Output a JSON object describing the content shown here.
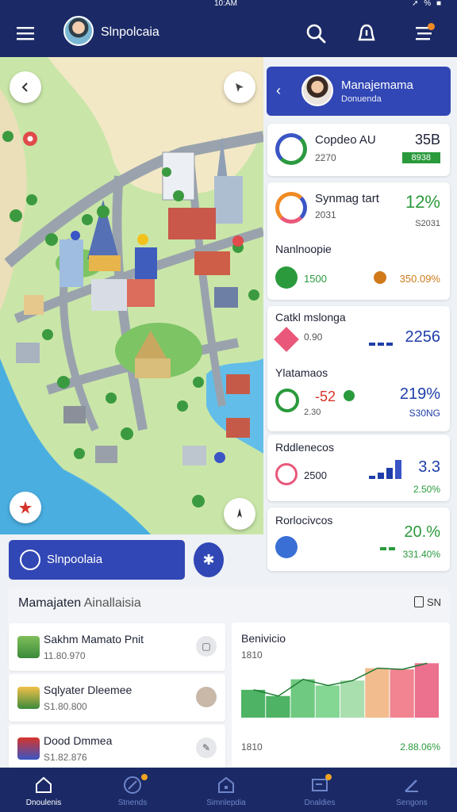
{
  "status_bar": {
    "time": "10:AM",
    "icons": "➚ % ■"
  },
  "app_bar": {
    "title": "Slnpolcaia"
  },
  "details_panel": {
    "header": {
      "title": "Manajemama",
      "subtitle": "Donuenda"
    },
    "cards": [
      {
        "title": "Copdeo AU",
        "subtitle": "2270",
        "value": "35B",
        "badge": "8938"
      },
      {
        "title": "Synmag tart",
        "subtitle": "2031",
        "value": "12%",
        "sub_value": "S2031"
      },
      {
        "title": "Nanlnoopie",
        "left_value": "1500",
        "right_value": "350.09%"
      },
      {
        "title": "Catkl mslonga",
        "left_value": "0.90",
        "value": "2256"
      },
      {
        "title": "Ylatamaos",
        "left_value": "-52",
        "left_sub": "2.30",
        "value": "219%",
        "sub_value": "S30NG"
      },
      {
        "title": "Rddlenecos",
        "left_value": "2500",
        "value": "3.3",
        "sub_value": "2.50%"
      },
      {
        "title": "Rorlocivcos",
        "value": "20.%",
        "sub_value": "331.40%"
      }
    ]
  },
  "map_cta": {
    "label": "Slnpoolaia"
  },
  "bottom_sheet": {
    "title": "Mamajaten",
    "title_suffix": "Ainallaisia",
    "action": "SN",
    "list": [
      {
        "name": "Sakhm Mamato Pnit",
        "sub": "11.80.970"
      },
      {
        "name": "Sqlyater Dleemee",
        "sub": "S1.80.800"
      },
      {
        "name": "Dood Dmmea",
        "sub": "S1.82.876"
      }
    ],
    "chart_card": {
      "title": "Benivicio",
      "top_value": "1810",
      "bottom_left": "1810",
      "bottom_right": "2.88.06%"
    }
  },
  "chart_data": {
    "type": "area",
    "series": [
      {
        "values": [
          45,
          35,
          62,
          52,
          60,
          80,
          78,
          88
        ]
      }
    ],
    "title": "Benivicio"
  },
  "bottom_nav": [
    {
      "label": "Dnoulenis",
      "icon": "home-icon",
      "active": true
    },
    {
      "label": "Stnends",
      "icon": "compass-icon",
      "active": false
    },
    {
      "label": "Simnlepdia",
      "icon": "house-icon",
      "active": false
    },
    {
      "label": "Dnaldies",
      "icon": "inbox-icon",
      "active": false
    },
    {
      "label": "Sengons",
      "icon": "pen-icon",
      "active": false
    }
  ],
  "colors": {
    "navy": "#1b2a66",
    "primary": "#3147b5",
    "green": "#2a9a3c",
    "pink": "#e9587a",
    "orange": "#f08a24"
  }
}
